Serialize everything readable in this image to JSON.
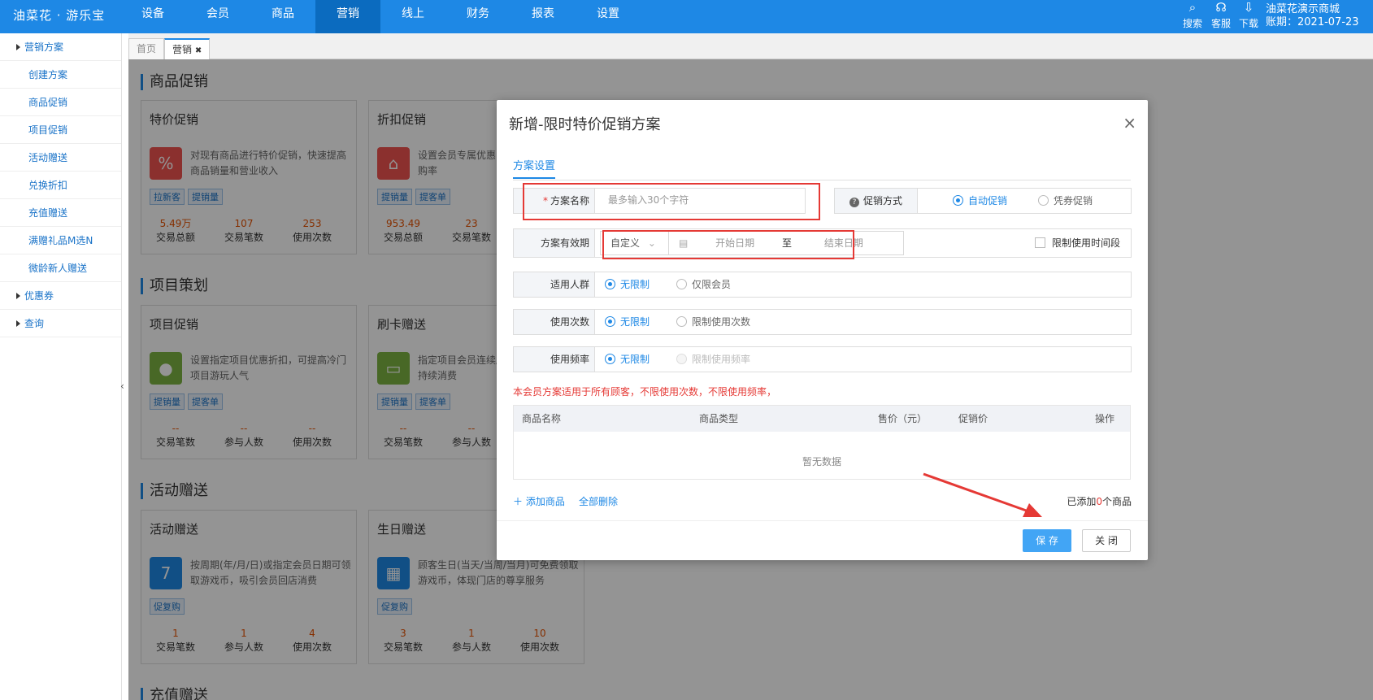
{
  "header": {
    "logo": "油菜花 · 游乐宝",
    "nav": [
      "设备",
      "会员",
      "商品",
      "营销",
      "线上",
      "财务",
      "报表",
      "设置"
    ],
    "active_nav": "营销",
    "tools": [
      {
        "icon": "search-icon",
        "label": "搜索"
      },
      {
        "icon": "headset-icon",
        "label": "客服"
      },
      {
        "icon": "download-icon",
        "label": "下载"
      }
    ],
    "shop_name": "油菜花演示商城",
    "period": "账期：2021-07-23"
  },
  "sidebar": {
    "groups": [
      {
        "label": "营销方案",
        "items": [
          "创建方案",
          "商品促销",
          "项目促销",
          "活动赠送",
          "兑换折扣",
          "充值赠送",
          "满赠礼品M选N",
          "微龄新人赠送"
        ]
      },
      {
        "label": "优惠券",
        "items": []
      },
      {
        "label": "查询",
        "items": []
      }
    ],
    "collapse_glyph": "‹"
  },
  "tabs": [
    {
      "label": "首页",
      "active": false
    },
    {
      "label": "营销",
      "active": true,
      "close": "✖"
    }
  ],
  "sections": [
    {
      "title": "商品促销",
      "cards": [
        {
          "title": "特价促销",
          "desc": "对现有商品进行特价促销，快速提高商品销量和营业收入",
          "tags": [
            "拉新客",
            "提销量"
          ],
          "icon": "percent-icon",
          "icon_color": "#ef5350",
          "stats": [
            {
              "v": "5.49万",
              "l": "交易总额"
            },
            {
              "v": "107",
              "l": "交易笔数"
            },
            {
              "v": "253",
              "l": "使用次数"
            }
          ]
        },
        {
          "title": "折扣促销",
          "desc": "设置会员专属优惠，提高会员回店复购率",
          "tags": [
            "提销量",
            "提客单"
          ],
          "icon": "tag-icon",
          "icon_color": "#ef5350",
          "stats": [
            {
              "v": "953.49",
              "l": "交易总额"
            },
            {
              "v": "23",
              "l": "交易笔数"
            }
          ]
        }
      ]
    },
    {
      "title": "项目策划",
      "cards": [
        {
          "title": "项目促销",
          "desc": "设置指定项目优惠折扣，可提高冷门项目游玩人气",
          "tags": [
            "提销量",
            "提客单"
          ],
          "icon": "balloon-icon",
          "icon_color": "#7cb342",
          "stats": [
            {
              "v": "--",
              "l": "交易笔数"
            },
            {
              "v": "--",
              "l": "参与人数"
            },
            {
              "v": "--",
              "l": "使用次数"
            }
          ]
        },
        {
          "title": "刷卡赠送",
          "desc": "指定项目会员连续刷卡次，刺激会员持续消费",
          "tags": [
            "提销量",
            "提客单"
          ],
          "icon": "card-icon",
          "icon_color": "#7cb342",
          "stats": [
            {
              "v": "--",
              "l": "交易笔数"
            },
            {
              "v": "--",
              "l": "参与人数"
            }
          ]
        }
      ]
    },
    {
      "title": "活动赠送",
      "cards": [
        {
          "title": "活动赠送",
          "desc": "按周期(年/月/日)或指定会员日期可领取游戏币，吸引会员回店消费",
          "tags": [
            "促复购"
          ],
          "icon": "calendar-icon",
          "icon_color": "#1e88e5",
          "icon_text": "7",
          "stats": [
            {
              "v": "1",
              "l": "交易笔数"
            },
            {
              "v": "1",
              "l": "参与人数"
            },
            {
              "v": "4",
              "l": "使用次数"
            }
          ]
        },
        {
          "title": "生日赠送",
          "desc": "顾客生日(当天/当周/当月)可免费领取游戏币，体现门店的尊享服务",
          "tags": [
            "促复购"
          ],
          "icon": "calendar-icon",
          "icon_color": "#1e88e5",
          "icon_text": "▦",
          "stats": [
            {
              "v": "3",
              "l": "交易笔数"
            },
            {
              "v": "1",
              "l": "参与人数"
            },
            {
              "v": "10",
              "l": "使用次数"
            }
          ]
        }
      ]
    },
    {
      "title": "充值赠送",
      "cards": []
    }
  ],
  "modal": {
    "title": "新增-限时特价促销方案",
    "close": "×",
    "tab": "方案设置",
    "name_label": "方案名称",
    "name_required": "*",
    "name_placeholder": "最多输入30个字符",
    "promo_help_icon": "?",
    "promo_label": "促销方式",
    "promo_options": [
      "自动促销",
      "凭券促销"
    ],
    "validity_label": "方案有效期",
    "validity_select": "自定义",
    "start_placeholder": "开始日期",
    "to": "至",
    "end_placeholder": "结束日期",
    "limit_time_label": "限制使用时间段",
    "audience_label": "适用人群",
    "audience_options": [
      "无限制",
      "仅限会员"
    ],
    "uses_label": "使用次数",
    "uses_options": [
      "无限制",
      "限制使用次数"
    ],
    "freq_label": "使用频率",
    "freq_options": [
      "无限制",
      "限制使用频率"
    ],
    "note": "本会员方案适用于所有顾客，不限使用次数，不限使用频率，",
    "table_headers": [
      "商品名称",
      "商品类型",
      "售价（元）",
      "促销价",
      "操作"
    ],
    "empty": "暂无数据",
    "add_goods": "＋ 添加商品",
    "delete_all": "全部删除",
    "count_prefix": "已添加",
    "count_value": "0",
    "count_suffix": "个商品",
    "save": "保 存",
    "close_btn": "关 闭"
  }
}
